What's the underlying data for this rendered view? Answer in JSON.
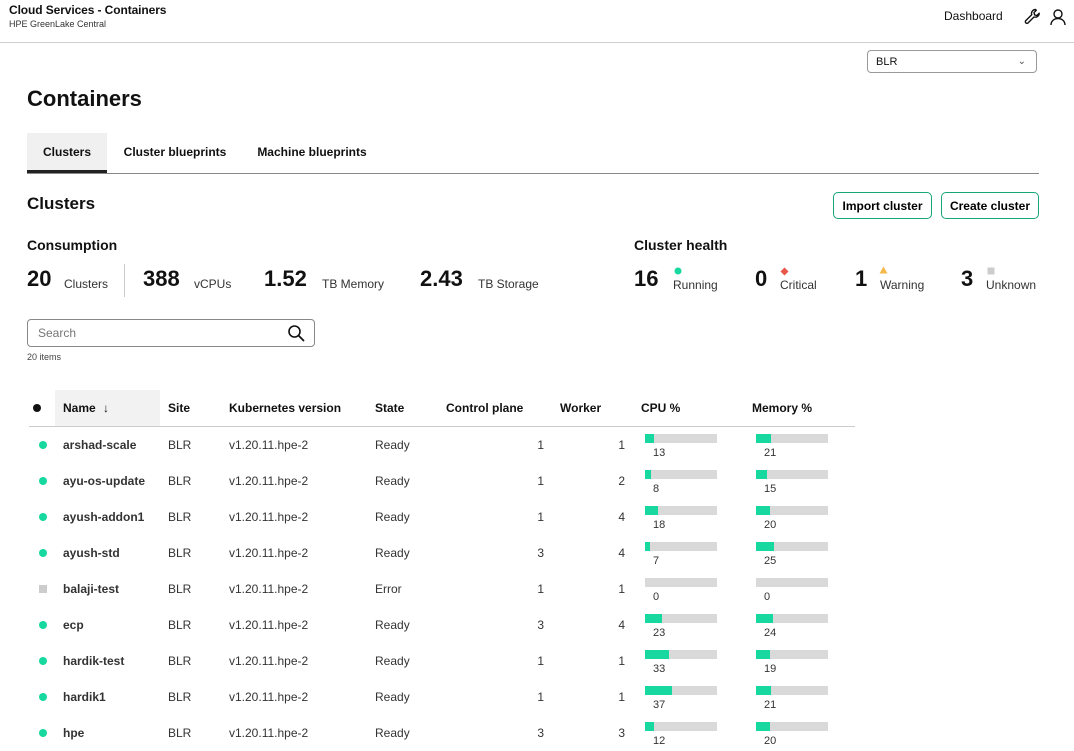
{
  "header": {
    "title": "Cloud Services - Containers",
    "subtitle": "HPE GreenLake Central",
    "dashboard_label": "Dashboard"
  },
  "site_select": {
    "value": "BLR"
  },
  "page_title": "Containers",
  "tabs": [
    {
      "label": "Clusters",
      "active": true
    },
    {
      "label": "Cluster blueprints",
      "active": false
    },
    {
      "label": "Machine blueprints",
      "active": false
    }
  ],
  "section_title": "Clusters",
  "buttons": {
    "import": "Import cluster",
    "create": "Create cluster"
  },
  "consumption": {
    "title": "Consumption",
    "stats": [
      {
        "value": "20",
        "label": "Clusters"
      },
      {
        "value": "388",
        "label": "vCPUs"
      },
      {
        "value": "1.52",
        "label": "TB Memory"
      },
      {
        "value": "2.43",
        "label": "TB Storage"
      }
    ]
  },
  "health": {
    "title": "Cluster health",
    "stats": [
      {
        "value": "16",
        "label": "Running",
        "icon": "running-dot-icon",
        "color": "#17d9a0"
      },
      {
        "value": "0",
        "label": "Critical",
        "icon": "critical-diamond-icon",
        "color": "#e8574a"
      },
      {
        "value": "1",
        "label": "Warning",
        "icon": "warning-triangle-icon",
        "color": "#f5b84a"
      },
      {
        "value": "3",
        "label": "Unknown",
        "icon": "unknown-square-icon",
        "color": "#cccccc"
      }
    ]
  },
  "search": {
    "placeholder": "Search",
    "count": "20 items"
  },
  "table": {
    "columns": [
      "Name",
      "Site",
      "Kubernetes version",
      "State",
      "Control plane",
      "Worker",
      "CPU %",
      "Memory %"
    ],
    "sort_indicator": "↓",
    "rows": [
      {
        "status": "running",
        "name": "arshad-scale",
        "site": "BLR",
        "version": "v1.20.11.hpe-2",
        "state": "Ready",
        "control_plane": "1",
        "worker": "1",
        "cpu": "13",
        "memory": "21"
      },
      {
        "status": "running",
        "name": "ayu-os-update",
        "site": "BLR",
        "version": "v1.20.11.hpe-2",
        "state": "Ready",
        "control_plane": "1",
        "worker": "2",
        "cpu": "8",
        "memory": "15"
      },
      {
        "status": "running",
        "name": "ayush-addon1",
        "site": "BLR",
        "version": "v1.20.11.hpe-2",
        "state": "Ready",
        "control_plane": "1",
        "worker": "4",
        "cpu": "18",
        "memory": "20"
      },
      {
        "status": "running",
        "name": "ayush-std",
        "site": "BLR",
        "version": "v1.20.11.hpe-2",
        "state": "Ready",
        "control_plane": "3",
        "worker": "4",
        "cpu": "7",
        "memory": "25"
      },
      {
        "status": "unknown",
        "name": "balaji-test",
        "site": "BLR",
        "version": "v1.20.11.hpe-2",
        "state": "Error",
        "control_plane": "1",
        "worker": "1",
        "cpu": "0",
        "memory": "0"
      },
      {
        "status": "running",
        "name": "ecp",
        "site": "BLR",
        "version": "v1.20.11.hpe-2",
        "state": "Ready",
        "control_plane": "3",
        "worker": "4",
        "cpu": "23",
        "memory": "24"
      },
      {
        "status": "running",
        "name": "hardik-test",
        "site": "BLR",
        "version": "v1.20.11.hpe-2",
        "state": "Ready",
        "control_plane": "1",
        "worker": "1",
        "cpu": "33",
        "memory": "19"
      },
      {
        "status": "running",
        "name": "hardik1",
        "site": "BLR",
        "version": "v1.20.11.hpe-2",
        "state": "Ready",
        "control_plane": "1",
        "worker": "1",
        "cpu": "37",
        "memory": "21"
      },
      {
        "status": "running",
        "name": "hpe",
        "site": "BLR",
        "version": "v1.20.11.hpe-2",
        "state": "Ready",
        "control_plane": "3",
        "worker": "3",
        "cpu": "12",
        "memory": "20"
      }
    ]
  }
}
